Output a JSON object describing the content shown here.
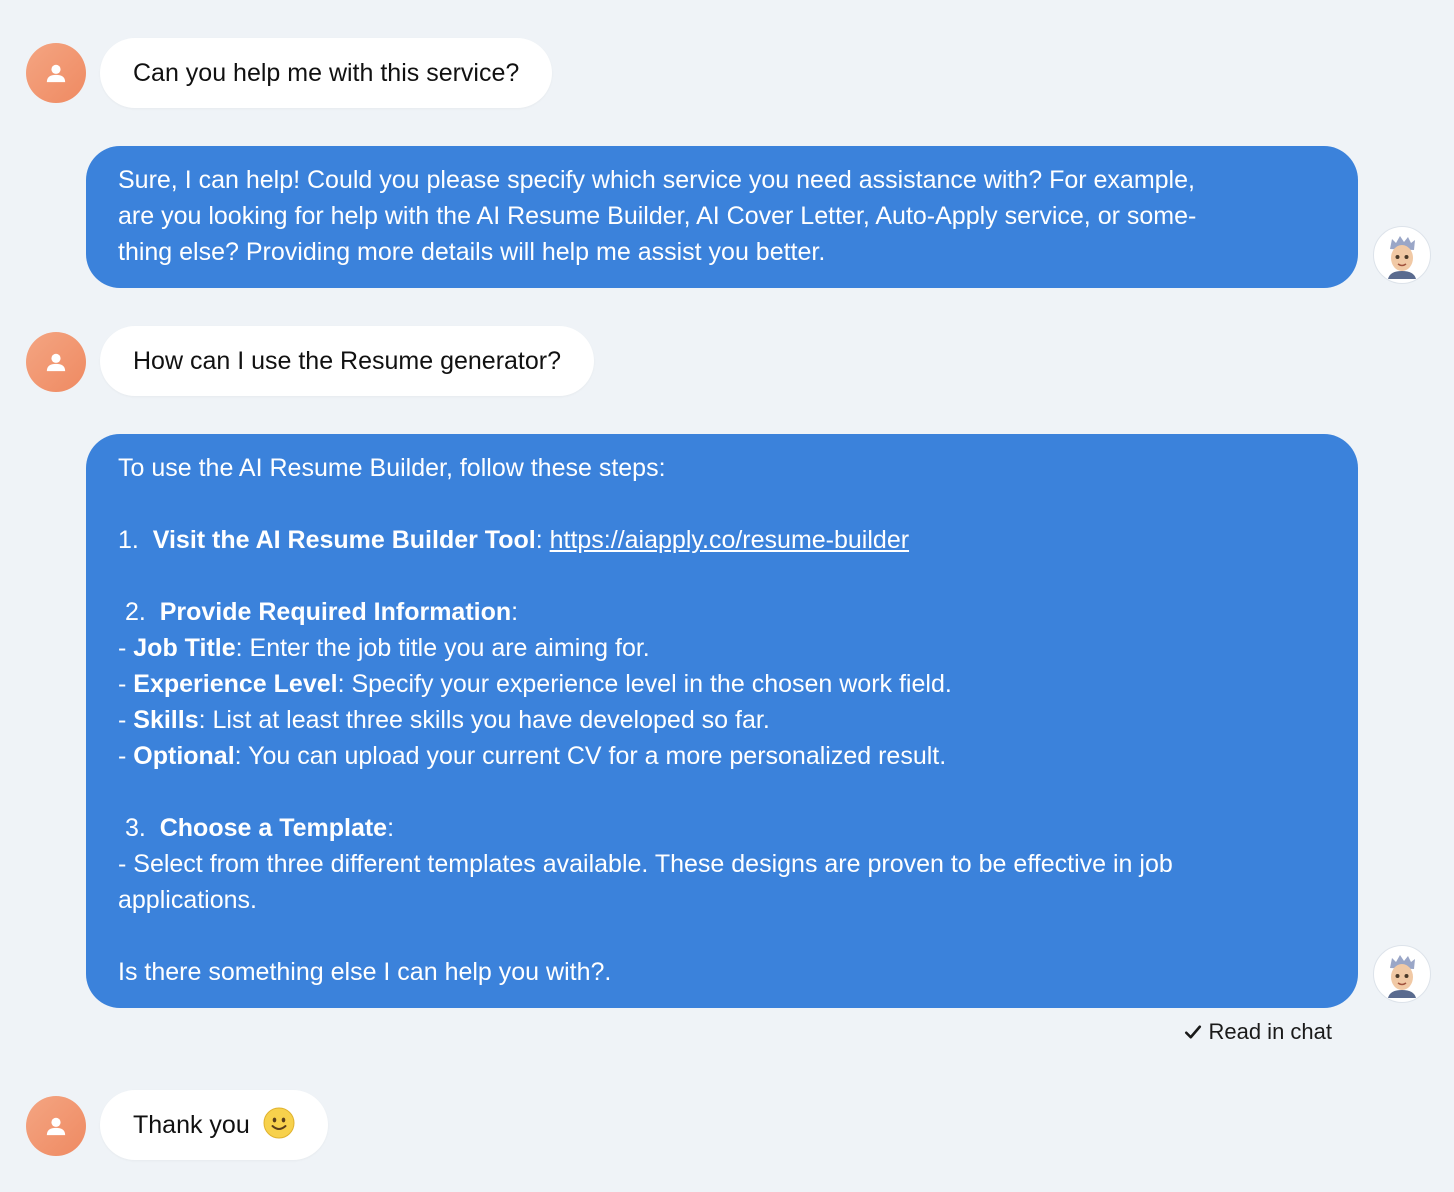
{
  "messages": [
    {
      "role": "user",
      "text": "Can you help me with this service?"
    },
    {
      "role": "agent",
      "text": "Sure, I can help! Could you please specify which service you need assistance with? For example, are you looking for help with the AI Resume Builder, AI Cover Letter, Auto-Apply service, or some- thing else? Providing more details will help me assist you better.",
      "lines": [
        "Sure, I can help! Could you please specify which service you need assistance with? For example,",
        "are you looking for help with the AI Resume Builder, AI Cover Letter, Auto-Apply service, or some-",
        "thing else? Providing more details will help me assist you better."
      ]
    },
    {
      "role": "user",
      "text": "How can I use the Resume generator?"
    },
    {
      "role": "agent",
      "intro": "To use the AI Resume Builder, follow these steps:",
      "step1": {
        "num": "1.",
        "title": "Visit the AI Resume Builder Tool",
        "sep": ":",
        "link": "https://aiapply.co/resume-builder"
      },
      "step2": {
        "num": "2.",
        "title": "Provide Required Information",
        "sep": ":",
        "items": [
          {
            "label": "Job Title",
            "text": ": Enter the job title you are aiming for."
          },
          {
            "label": "Experience Level",
            "text": ": Specify your experience level in the chosen work field."
          },
          {
            "label": "Skills",
            "text": ": List at least three skills you have developed so far."
          },
          {
            "label": "Optional",
            "text": ": You can upload your current CV for a more personalized result."
          }
        ]
      },
      "step3": {
        "num": "3.",
        "title": "Choose a Template",
        "sep": ":",
        "line1": "- Select from three different templates available. These designs are proven to be effective in job",
        "line2": "applications."
      },
      "closing": "Is there something else I can help you with?."
    },
    {
      "role": "user",
      "text": "Thank you",
      "emoji": "slightly-smiling-face"
    }
  ],
  "status": {
    "read_label": "Read in chat",
    "icon": "checkmark-icon"
  },
  "colors": {
    "agent_bubble": "#3b82db",
    "user_bubble": "#ffffff",
    "background": "#eff3f7",
    "user_avatar": "#ef8a62"
  },
  "icons": {
    "user_avatar": "user-silhouette-icon",
    "agent_avatar": "memoji-avatar-icon"
  }
}
